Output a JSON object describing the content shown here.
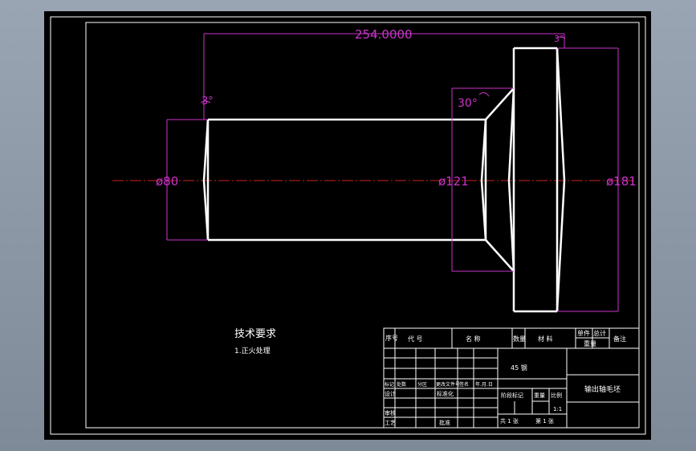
{
  "dimensions": {
    "length": "254.0000",
    "dia_left": "ø80",
    "dia_mid": "ø121",
    "dia_right": "ø181",
    "angle_left": "3°",
    "angle_mid": "30°",
    "angle_right": "3°"
  },
  "technical_requirements": {
    "title": "技术要求",
    "item1": "1.正火处理"
  },
  "title_block": {
    "header": {
      "seq": "序号",
      "code": "代  号",
      "name": "名  称",
      "qty": "数量",
      "material": "材  料",
      "unit": "单件",
      "total": "总计",
      "weight": "重量",
      "remark": "备注"
    },
    "material_value": "45 钢",
    "part_name": "输出轴毛坯",
    "rev_row": {
      "mark": "标记",
      "count": "处数",
      "zone": "分区",
      "doc": "更改文件号",
      "sign": "签名",
      "date": "年.月.日"
    },
    "design": "设计",
    "standard": "标准化",
    "review": "审核",
    "process": "工艺",
    "approve": "批准",
    "stage_mark": "阶段标记",
    "weight": "重量",
    "scale": "比例",
    "scale_value": "1:1",
    "sheets": "共 1 张",
    "sheet": "第 1 张"
  },
  "colors": {
    "background": "#000000",
    "geometry": "#ffffff",
    "dimension": "#cc33cc",
    "centerline": "#cc1f1f",
    "sheet_border": "#ffffff"
  }
}
